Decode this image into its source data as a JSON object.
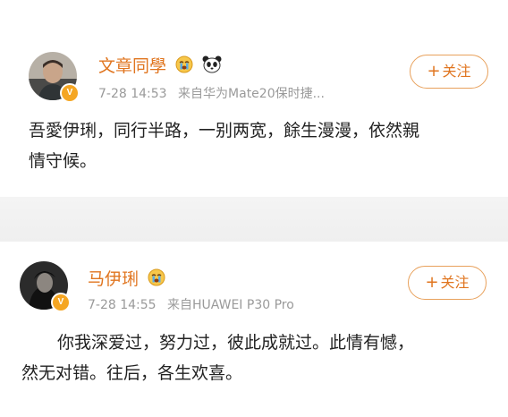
{
  "posts": [
    {
      "author": "文章同學",
      "time": "7-28 14:53",
      "source": "来自华为Mate20保时捷...",
      "follow_label": "关注",
      "follow_plus": "+",
      "content_line1": "吾愛伊琍，同行半路，一别两宽，餘生漫漫，依然親",
      "content_line2": "情守候。"
    },
    {
      "author": "马伊琍",
      "time": "7-28 14:55",
      "source": "来自HUAWEI P30 Pro",
      "follow_label": "关注",
      "follow_plus": "+",
      "content_line1": "你我深爱过，努力过，彼此成就过。此情有憾，",
      "content_line2": "然无对错。往后，各生欢喜。"
    }
  ],
  "verified_badge": "V",
  "colors": {
    "name": "#e0751f",
    "meta": "#9a9a9a",
    "follow_border": "#e8a15c",
    "verified": "#f5a623"
  },
  "icons": [
    "crying-face-icon",
    "panda-icon",
    "verified-badge-icon",
    "plus-icon"
  ]
}
